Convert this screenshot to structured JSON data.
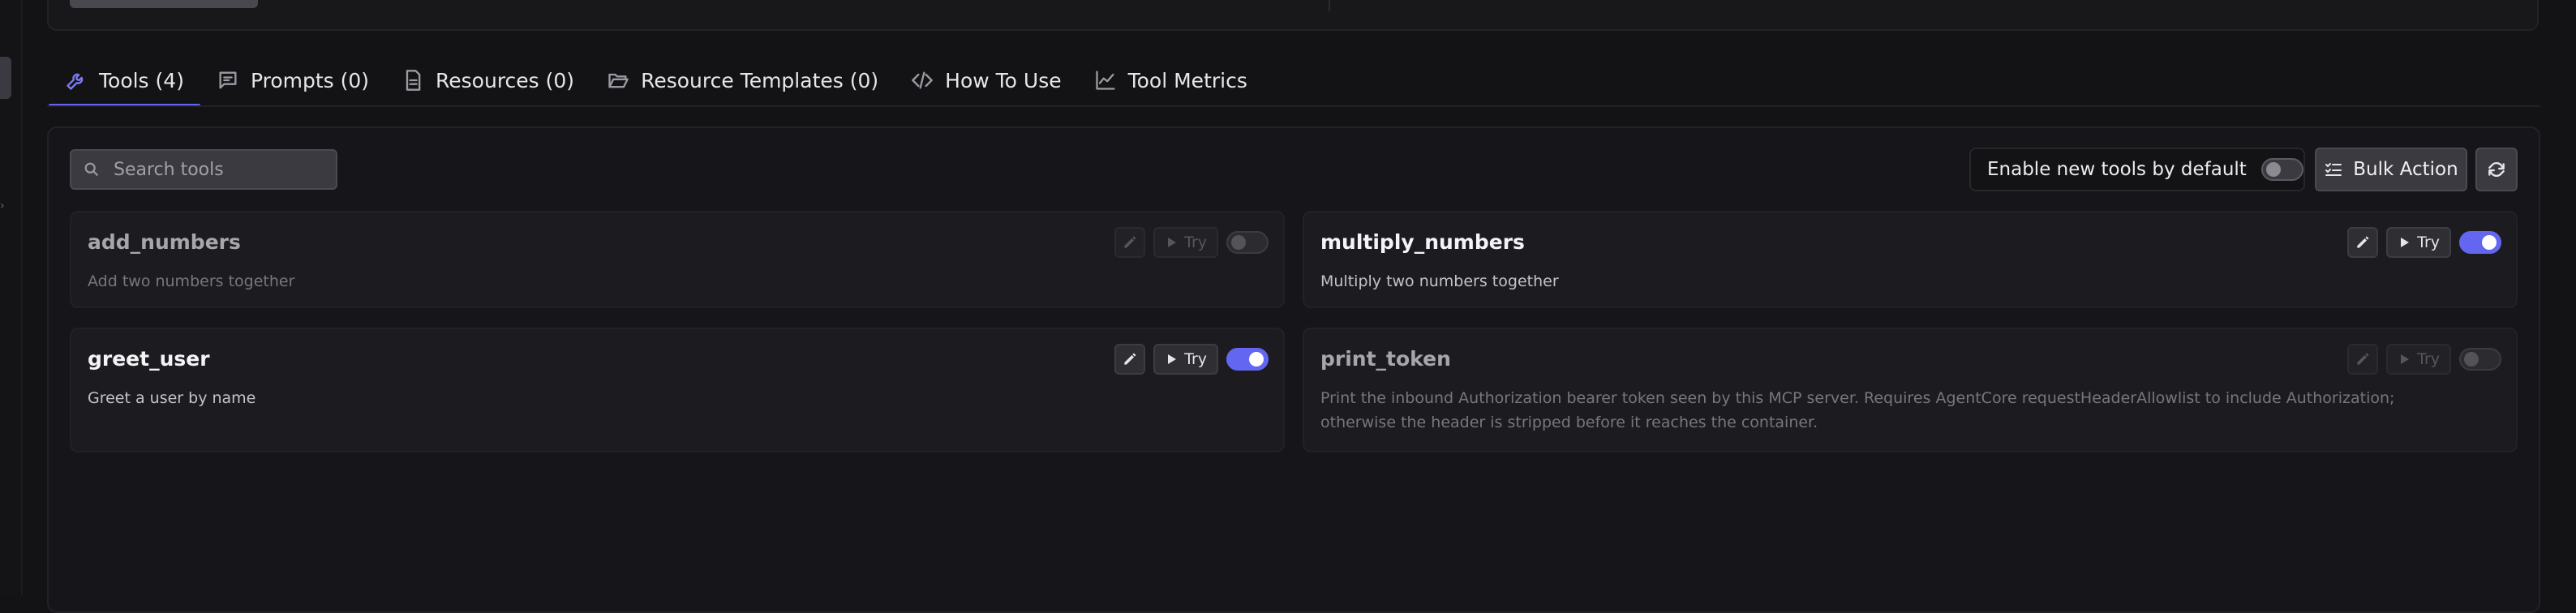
{
  "tabs": [
    {
      "label": "Tools (4)",
      "icon": "wrench-icon",
      "active": true
    },
    {
      "label": "Prompts (0)",
      "icon": "message-square-icon",
      "active": false
    },
    {
      "label": "Resources (0)",
      "icon": "file-icon",
      "active": false
    },
    {
      "label": "Resource Templates (0)",
      "icon": "folder-open-icon",
      "active": false
    },
    {
      "label": "How To Use",
      "icon": "code-icon",
      "active": false
    },
    {
      "label": "Tool Metrics",
      "icon": "line-chart-icon",
      "active": false
    }
  ],
  "toolbar": {
    "search_placeholder": "Search tools",
    "enable_label": "Enable new tools by default",
    "enable_default_on": false,
    "bulk_label": "Bulk Action"
  },
  "tools": [
    {
      "name": "add_numbers",
      "description": "Add two numbers together",
      "enabled": false,
      "try_label": "Try"
    },
    {
      "name": "multiply_numbers",
      "description": "Multiply two numbers together",
      "enabled": true,
      "try_label": "Try"
    },
    {
      "name": "greet_user",
      "description": "Greet a user by name",
      "enabled": true,
      "try_label": "Try"
    },
    {
      "name": "print_token",
      "description": "Print the inbound Authorization bearer token seen by this MCP server. Requires AgentCore requestHeaderAllowlist to include Authorization; otherwise the header is stripped before it reaches the container.",
      "enabled": false,
      "try_label": "Try"
    }
  ],
  "colors": {
    "accent": "#6366f1",
    "background": "#131316",
    "card": "#1c1c20"
  }
}
